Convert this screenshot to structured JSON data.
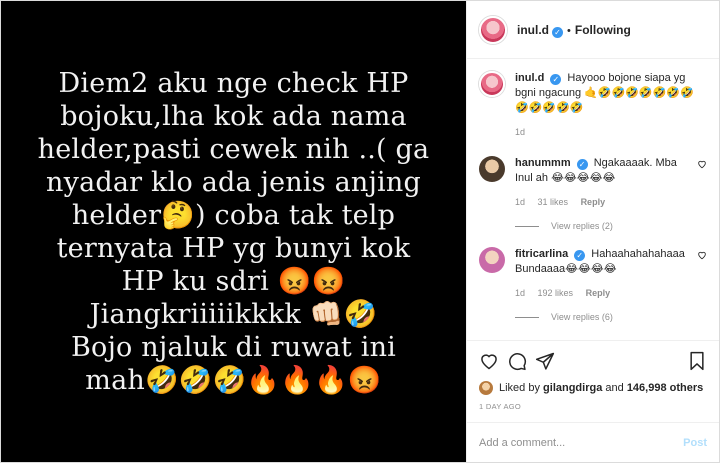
{
  "post": {
    "media_text": "Diem2 aku nge check HP\nbojoku,lha kok ada nama\nhelder,pasti cewek nih ..( ga\nnyadar klo ada jenis anjing\nhelder🤔) coba tak telp\nternyata HP yg bunyi kok\nHP ku sdri 😡😡\nJiangkriiiiikkkk 👊🏻🤣\nBojo njaluk di ruwat ini\nmah🤣🤣🤣🔥🔥🔥😡"
  },
  "header": {
    "username": "inul.d",
    "verified": "✓",
    "separator": "•",
    "follow_status": "Following"
  },
  "caption": {
    "username": "inul.d",
    "text": "Hayooo bojone siapa yg bgni ngacung 🤙🤣🤣🤣🤣🤣🤣🤣🤣🤣🤣🤣🤣",
    "time": "1d"
  },
  "comments": [
    {
      "username": "hanummm",
      "text": "Ngakaaaak. Mba Inul ah 😂😂😂😂😂",
      "time": "1d",
      "likes": "31 likes",
      "reply": "Reply",
      "view_replies": "View replies (2)",
      "avatar_color": "#5a4a3a"
    },
    {
      "username": "fitricarlina",
      "text": "Hahaahahahahaaa Bundaaaa😂😂😂😂",
      "time": "1d",
      "likes": "192 likes",
      "reply": "Reply",
      "view_replies": "View replies (6)",
      "avatar_color": "#d98cc0"
    }
  ],
  "likes": {
    "prefix": "Liked by",
    "user": "gilangdirga",
    "and": "and",
    "others": "146,998 others"
  },
  "posted_ago": "1 DAY AGO",
  "add_comment": {
    "placeholder": "Add a comment...",
    "post_label": "Post"
  },
  "icons": [
    "heart-icon",
    "comment-icon",
    "share-icon",
    "bookmark-icon",
    "comment-like-icon"
  ]
}
